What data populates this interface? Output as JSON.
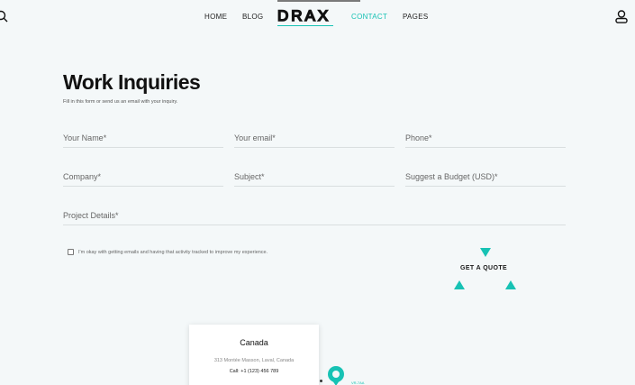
{
  "header": {
    "nav": [
      "HOME",
      "BLOG",
      "CONTACT",
      "PAGES"
    ],
    "logo": "DRAX",
    "accent_color": "#17c2b4"
  },
  "main": {
    "title": "Work Inquiries",
    "subtitle": "Fill in this form or send us an email with your inquiry.",
    "fields": {
      "name": "Your Name*",
      "email": "Your email*",
      "phone": "Phone*",
      "company": "Company*",
      "subject": "Subject*",
      "budget": "Suggest a Budget (USD)*",
      "details": "Project Details*"
    },
    "consent": "I'm okay with getting emails and having that activity tracked to improve my experience.",
    "submit": "GET A QUOTE"
  },
  "location": {
    "country": "Canada",
    "address": "313 Montée Masson, Laval, Canada",
    "call": "Call: +1 (123) 456 789",
    "map_label": "VR-7AA"
  },
  "icons": [
    "search-icon",
    "user-icon",
    "map-pin-icon",
    "triangle-icon"
  ]
}
